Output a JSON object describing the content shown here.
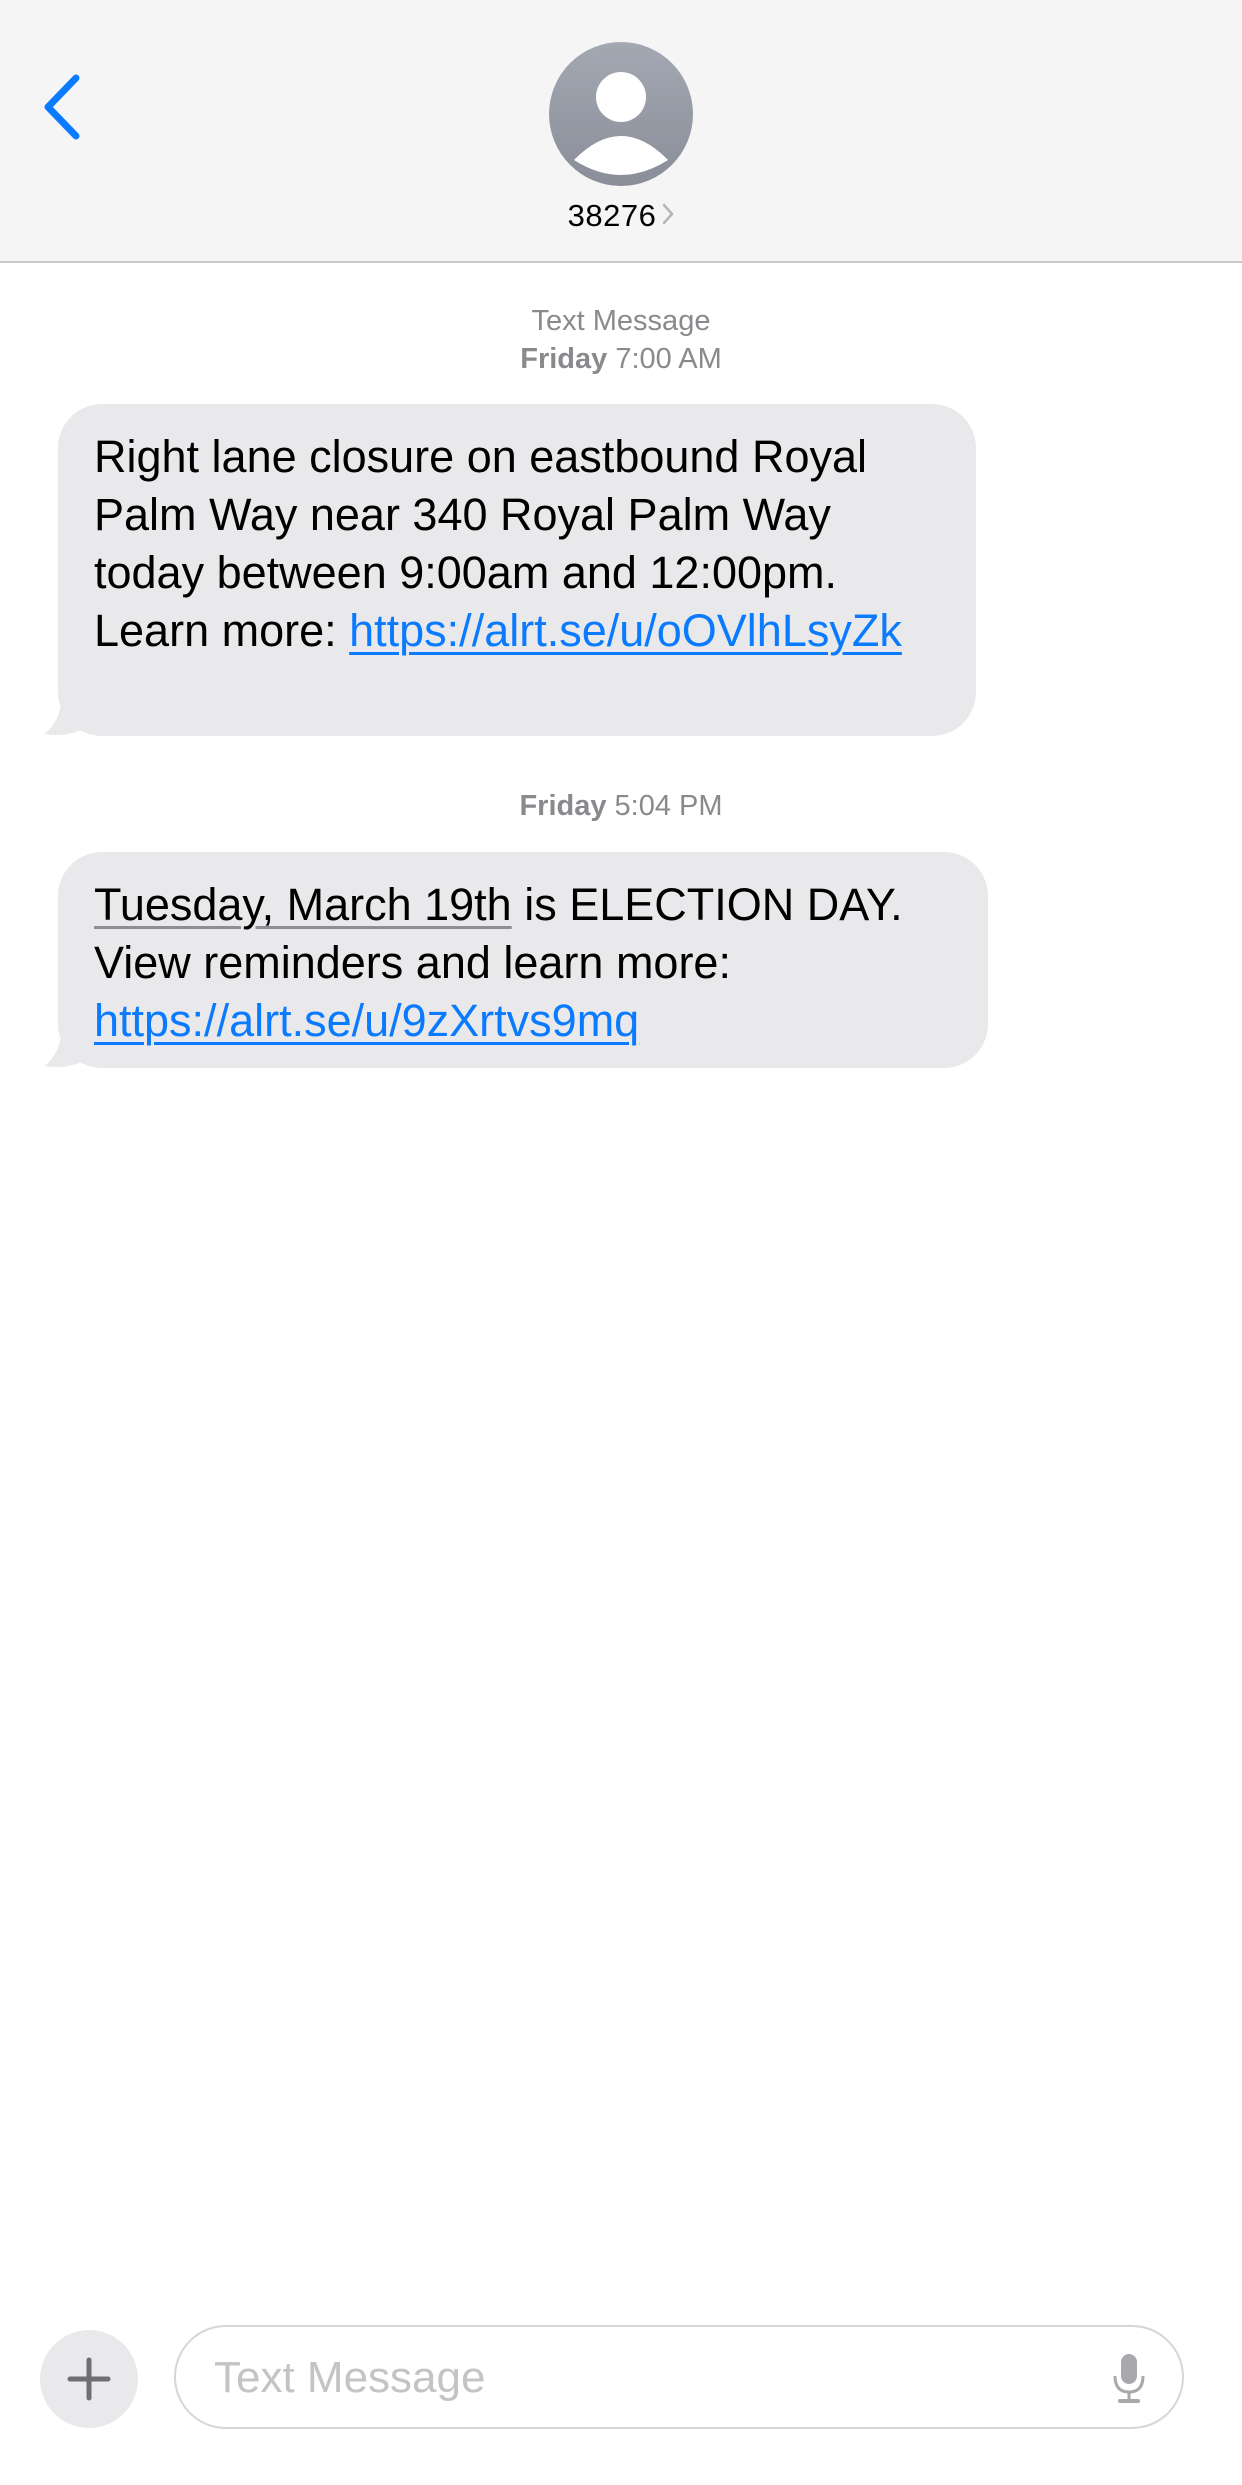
{
  "header": {
    "back_icon": "chevron-left-icon",
    "avatar_icon": "person-placeholder-icon",
    "contact_name": "38276",
    "contact_chevron_icon": "chevron-right-icon"
  },
  "colors": {
    "accent": "#0a7aff",
    "bubble": "#e9e9eb",
    "timestamp": "#8a8a8e",
    "header_bg": "#f5f5f5"
  },
  "conversation": {
    "groups": [
      {
        "label": "Text Message",
        "day": "Friday",
        "time": "7:00 AM",
        "message": {
          "text": "Right lane closure on eastbound Royal Palm Way near 340 Royal Palm Way today between 9:00am and 12:00pm. Learn more: ",
          "link": "https://alrt.se/u/oOVlhLsyZk"
        }
      },
      {
        "day": "Friday",
        "time": "5:04 PM",
        "message": {
          "date_link": "Tuesday, March 19th",
          "text": " is ELECTION DAY. View reminders and learn more: ",
          "link": "https://alrt.se/u/9zXrtvs9mq"
        }
      }
    ]
  },
  "composer": {
    "plus_icon": "plus-icon",
    "placeholder": "Text Message",
    "value": "",
    "mic_icon": "microphone-icon"
  }
}
